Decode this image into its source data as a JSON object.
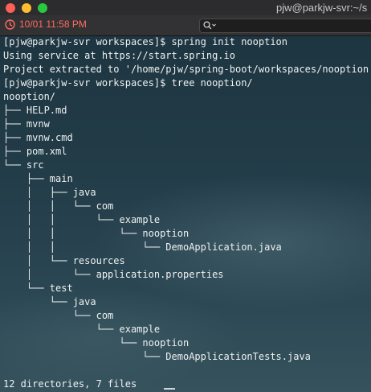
{
  "window": {
    "title": "pjw@parkjw-svr:~/s",
    "colors": {
      "close": "#fe5f57",
      "minimize": "#febc2e",
      "zoom": "#28c840",
      "timestamp": "#ff6a5c",
      "text": "#eef2f2"
    }
  },
  "toolbar": {
    "timestamp": "10/01 11:58 PM",
    "timestamp_icon": "clock-icon",
    "search_icon": "search-icon"
  },
  "terminal": {
    "lines": [
      "[pjw@parkjw-svr workspaces]$ spring init nooption",
      "Using service at https://start.spring.io",
      "Project extracted to '/home/pjw/spring-boot/workspaces/nooption'",
      "[pjw@parkjw-svr workspaces]$ tree nooption/",
      "nooption/",
      "├── HELP.md",
      "├── mvnw",
      "├── mvnw.cmd",
      "├── pom.xml",
      "└── src",
      "    ├── main",
      "    │   ├── java",
      "    │   │   └── com",
      "    │   │       └── example",
      "    │   │           └── nooption",
      "    │   │               └── DemoApplication.java",
      "    │   └── resources",
      "    │       └── application.properties",
      "    └── test",
      "        └── java",
      "            └── com",
      "                └── example",
      "                    └── nooption",
      "                        └── DemoApplicationTests.java",
      "",
      "12 directories, 7 files"
    ]
  }
}
